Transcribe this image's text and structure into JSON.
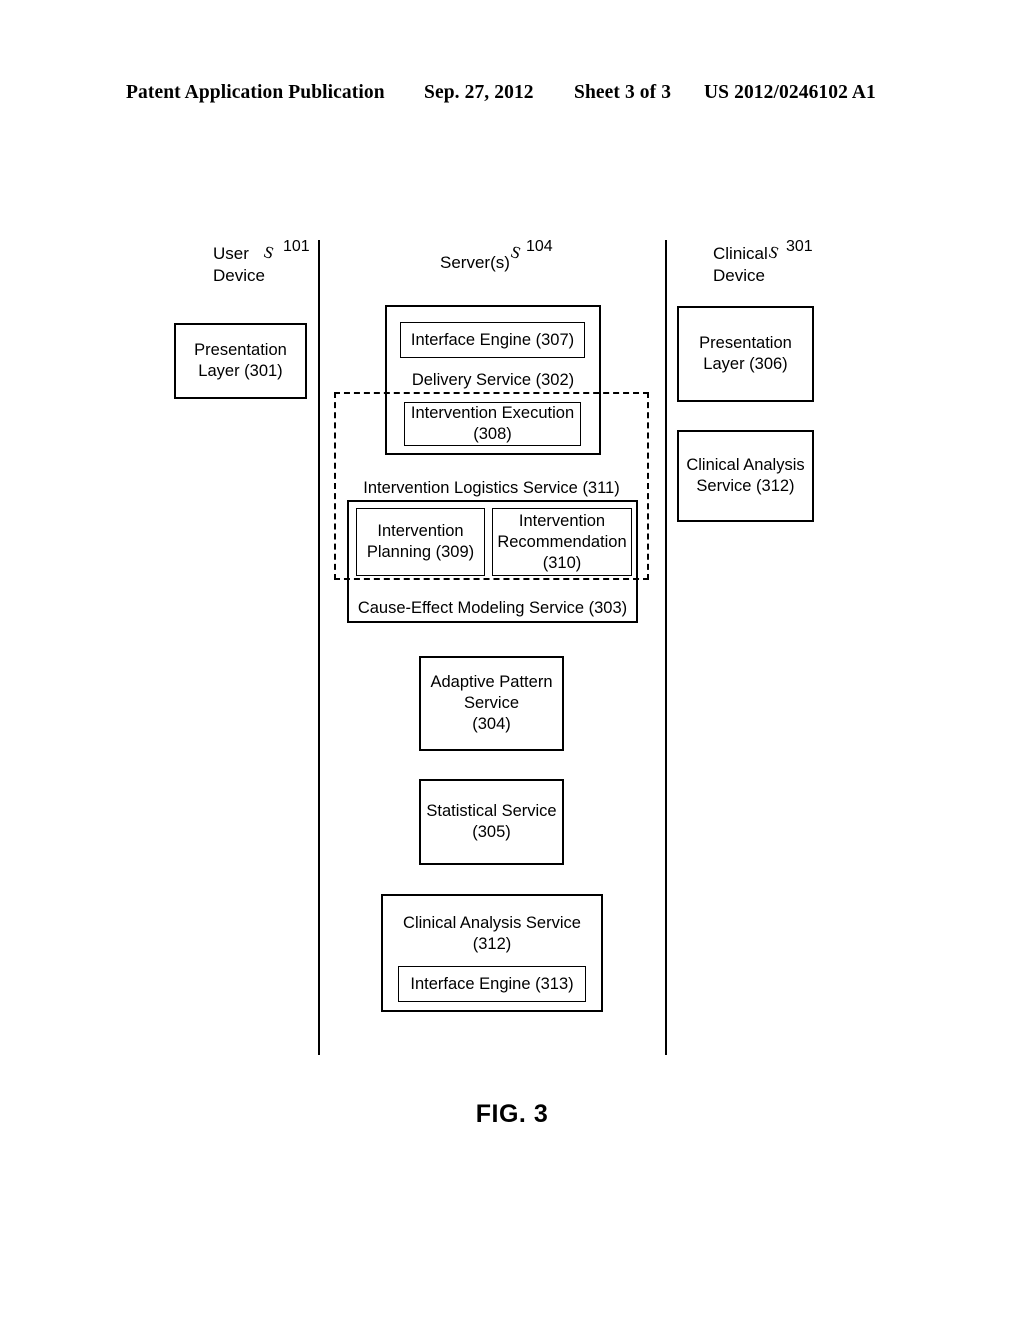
{
  "header": {
    "publication": "Patent Application Publication",
    "date": "Sep. 27, 2012",
    "sheet": "Sheet 3 of 3",
    "patent_number": "US 2012/0246102 A1"
  },
  "figure": {
    "caption": "FIG. 3",
    "leader_glyph": "S",
    "columns": [
      {
        "heading": "User\nDevice",
        "heading_line1": "User",
        "heading_line2": "Device",
        "ref": "101"
      },
      {
        "heading": "Server(s)",
        "ref": "104"
      },
      {
        "heading": "Clinical\nDevice",
        "heading_line1": "Clinical",
        "heading_line2": "Device",
        "ref": "301"
      }
    ],
    "user_device": {
      "presentation_layer": "Presentation\nLayer (301)"
    },
    "server": {
      "delivery_service": {
        "label": "Delivery Service (302)",
        "interface_engine": "Interface Engine (307)",
        "intervention_execution": "Intervention Execution\n(308)"
      },
      "intervention_logistics": {
        "label": "Intervention Logistics Service (311)"
      },
      "cause_effect_modeling": {
        "label": "Cause-Effect Modeling Service (303)",
        "intervention_planning": "Intervention\nPlanning (309)",
        "intervention_recommendation": "Intervention\nRecommendation\n(310)"
      },
      "adaptive_pattern_service": "Adaptive Pattern\nService\n(304)",
      "statistical_service": "Statistical Service\n(305)",
      "clinical_analysis_service": {
        "label": "Clinical Analysis Service\n(312)",
        "interface_engine": "Interface Engine (313)"
      }
    },
    "clinical_device": {
      "presentation_layer": "Presentation\nLayer (306)",
      "clinical_analysis_service": "Clinical Analysis\nService (312)"
    }
  }
}
